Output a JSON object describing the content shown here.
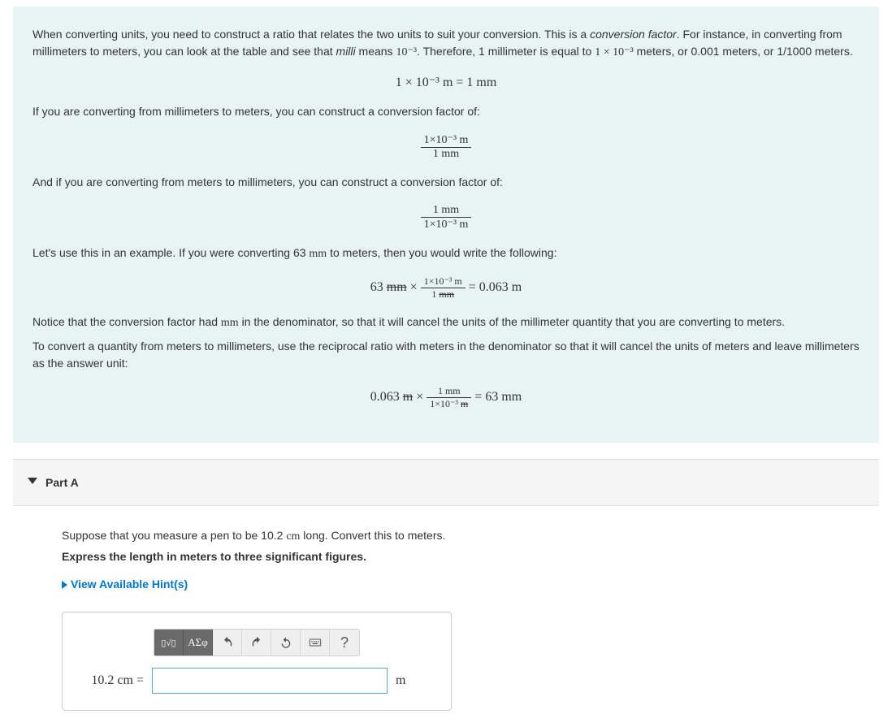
{
  "explain": {
    "p1_a": "When converting units, you need to construct a ratio that relates the two units to suit your conversion. This is a ",
    "p1_em": "conversion factor",
    "p1_b": ". For instance, in converting from millimeters to meters, you can look at the table and see that ",
    "p1_em2": "milli",
    "p1_c": " means ",
    "p1_exp": "10⁻³",
    "p1_d": ". Therefore, 1 millimeter is equal to ",
    "p1_val": "1 × 10⁻³",
    "p1_e": " meters, or 0.001 meters, or 1/1000 meters.",
    "f1": "1 × 10⁻³ m = 1 mm",
    "p2": "If you are converting from millimeters to meters, you can construct a conversion factor of:",
    "f2_num": "1×10⁻³ m",
    "f2_den": "1 mm",
    "p3": "And if you are converting from meters to millimeters, you can construct a conversion factor of:",
    "f3_num": "1 mm",
    "f3_den": "1×10⁻³ m",
    "p4_a": "Let's use this in an example. If you were converting 63 ",
    "p4_unit": "mm",
    "p4_b": " to meters, then you would write the following:",
    "f4_lhs": "63 ",
    "f4_strike1": "mm",
    "f4_times": " × ",
    "f4_num": "1×10⁻³ m",
    "f4_den_a": "1 ",
    "f4_den_strike": "mm",
    "f4_eq": " = 0.063 m",
    "p5_a": "Notice that the conversion factor had ",
    "p5_unit": "mm",
    "p5_b": " in the denominator, so that it will cancel the units of the millimeter quantity that you are converting to meters.",
    "p6": "To convert a quantity from meters to millimeters, use the reciprocal ratio with meters in the denominator so that it will cancel the units of meters and leave millimeters as the answer unit:",
    "f5_lhs": "0.063 ",
    "f5_strike1": "m",
    "f5_times": " × ",
    "f5_num": "1 mm",
    "f5_den_a": "1×10⁻³ ",
    "f5_den_strike": "m",
    "f5_eq": " = 63 mm"
  },
  "part": {
    "title": "Part A",
    "q1_a": "Suppose that you measure a pen to be 10.2 ",
    "q1_unit": "cm",
    "q1_b": " long. Convert this to meters.",
    "q2": "Express the length in meters to three significant figures.",
    "hint_label": "View Available Hint(s)",
    "lhs": "10.2 cm",
    "eq": " = ",
    "unit": "m",
    "toolbar": {
      "templates": "▯√▯",
      "greek": "ΑΣφ",
      "help": "?"
    },
    "answer_value": ""
  }
}
